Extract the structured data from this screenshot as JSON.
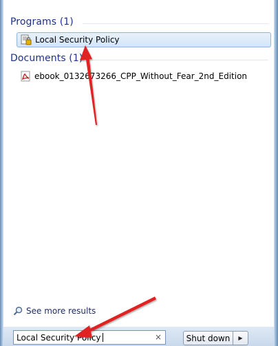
{
  "groups": {
    "programs": {
      "header": "Programs (1)",
      "items": [
        {
          "label": "Local Security Policy",
          "icon": "security-policy-icon"
        }
      ]
    },
    "documents": {
      "header": "Documents (1)",
      "items": [
        {
          "label": "ebook_0132673266_CPP_Without_Fear_2nd_Edition",
          "icon": "pdf-icon"
        }
      ]
    }
  },
  "see_more": {
    "label": "See more results",
    "icon": "search-icon"
  },
  "search": {
    "value": "Local Security Policy",
    "clear_glyph": "×"
  },
  "shutdown": {
    "label": "Shut down",
    "arrow_glyph": "▶"
  },
  "colors": {
    "header_text": "#1e3287",
    "selection_border": "#8fb4de",
    "annotation_arrow": "#e02020"
  }
}
